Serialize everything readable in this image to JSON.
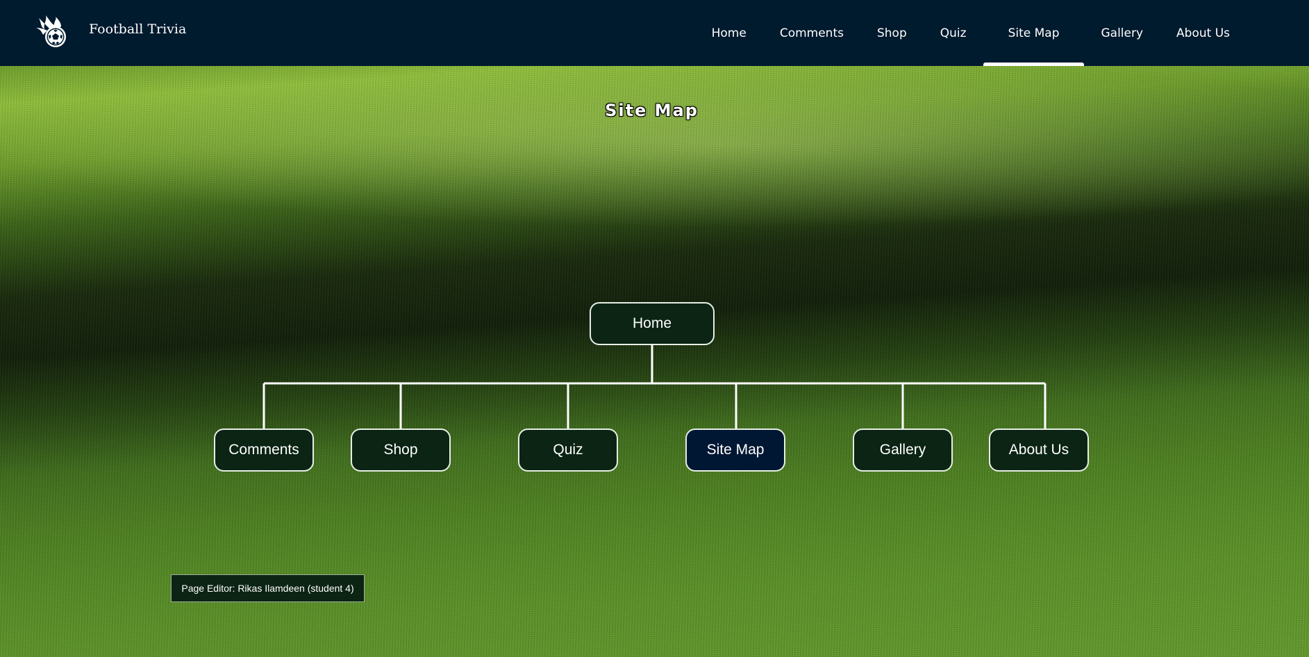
{
  "header": {
    "brand_name": "Football Trivia",
    "logo_icon": "flaming-football-icon"
  },
  "nav": {
    "items": [
      {
        "label": "Home"
      },
      {
        "label": "Comments"
      },
      {
        "label": "Shop"
      },
      {
        "label": "Quiz"
      },
      {
        "label": "Site Map",
        "active": true
      },
      {
        "label": "Gallery"
      },
      {
        "label": "About Us"
      }
    ]
  },
  "page_title": "Site Map",
  "sitemap": {
    "root": {
      "label": "Home"
    },
    "children": [
      {
        "label": "Comments"
      },
      {
        "label": "Shop"
      },
      {
        "label": "Quiz"
      },
      {
        "label": "Site Map",
        "current": true
      },
      {
        "label": "Gallery"
      },
      {
        "label": "About Us"
      }
    ]
  },
  "footer": {
    "editor_note": "Page Editor: Rikas Ilamdeen (student 4)"
  },
  "colors": {
    "navbar_bg": "#001a2e",
    "node_bg": "#0b2414",
    "current_node_bg": "#001733",
    "node_border": "#e6efe6"
  }
}
